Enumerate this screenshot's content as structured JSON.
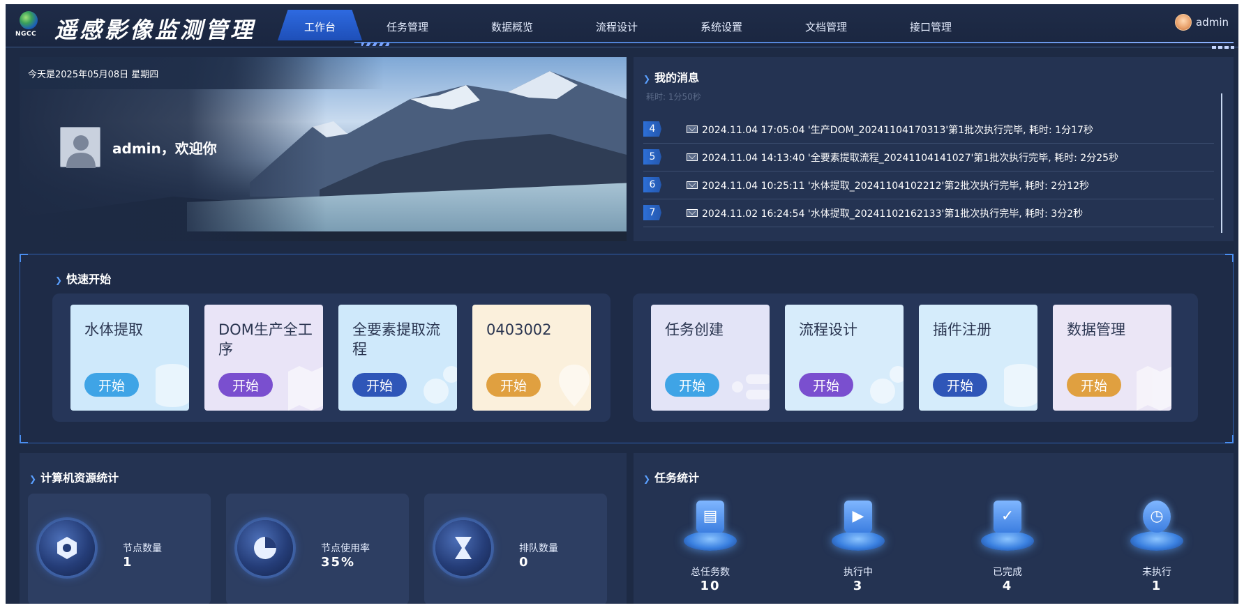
{
  "header": {
    "logo_text": "NGCC",
    "app_title": "遥感影像监测管理",
    "nav": [
      {
        "label": "工作台",
        "active": true
      },
      {
        "label": "任务管理",
        "active": false
      },
      {
        "label": "数据概览",
        "active": false
      },
      {
        "label": "流程设计",
        "active": false
      },
      {
        "label": "系统设置",
        "active": false
      },
      {
        "label": "文档管理",
        "active": false
      },
      {
        "label": "接口管理",
        "active": false
      }
    ],
    "user": {
      "name": "admin",
      "avatar_icon": "user-avatar-icon"
    }
  },
  "welcome": {
    "date_text": "今天是2025年05月08日 星期四",
    "greeting": "admin，欢迎你"
  },
  "messages": {
    "title": "我的消息",
    "faded_text": "耗时: 1分50秒",
    "items": [
      {
        "num": "4",
        "text": "2024.11.04 17:05:04  '生产DOM_20241104170313'第1批次执行完毕, 耗时: 1分17秒"
      },
      {
        "num": "5",
        "text": "2024.11.04 14:13:40  '全要素提取流程_20241104141027'第1批次执行完毕, 耗时: 2分25秒"
      },
      {
        "num": "6",
        "text": "2024.11.04 10:25:11  '水体提取_20241104102212'第2批次执行完毕, 耗时: 2分12秒"
      },
      {
        "num": "7",
        "text": "2024.11.02 16:24:54  '水体提取_20241102162133'第1批次执行完毕, 耗时: 3分2秒"
      }
    ]
  },
  "quick_start": {
    "title": "快速开始",
    "left_cards": [
      {
        "title": "水体提取",
        "button": "开始",
        "bg": "#cfe9fb",
        "btn_color": "#3fa4e6",
        "icon": "database-icon"
      },
      {
        "title": "DOM生产全工序",
        "button": "开始",
        "bg": "#e9e4f7",
        "btn_color": "#7a4fcf",
        "icon": "map-icon"
      },
      {
        "title": "全要素提取流程",
        "button": "开始",
        "bg": "#cfe9fb",
        "btn_color": "#2f56b8",
        "icon": "gear-icon"
      },
      {
        "title": "0403002",
        "button": "开始",
        "bg": "#fbf0dc",
        "btn_color": "#e0a040",
        "icon": "map-pin-icon"
      }
    ],
    "right_cards": [
      {
        "title": "任务创建",
        "button": "开始",
        "bg": "#e3e4f7",
        "btn_color": "#3fa4e6",
        "icon": "task-create-icon"
      },
      {
        "title": "流程设计",
        "button": "开始",
        "bg": "#d7ecfb",
        "btn_color": "#7a4fcf",
        "icon": "gear-icon"
      },
      {
        "title": "插件注册",
        "button": "开始",
        "bg": "#d5ecfb",
        "btn_color": "#2f56b8",
        "icon": "database-icon"
      },
      {
        "title": "数据管理",
        "button": "开始",
        "bg": "#ebe6f6",
        "btn_color": "#e0a040",
        "icon": "map-icon"
      }
    ]
  },
  "resources": {
    "title": "计算机资源统计",
    "items": [
      {
        "label": "节点数量",
        "value": "1",
        "icon": "node-icon"
      },
      {
        "label": "节点使用率",
        "value": "35%",
        "icon": "pie-chart-icon"
      },
      {
        "label": "排队数量",
        "value": "0",
        "icon": "hourglass-icon"
      }
    ]
  },
  "tasks": {
    "title": "任务统计",
    "items": [
      {
        "label": "总任务数",
        "value": "10",
        "icon": "clipboard-icon",
        "glyph": "▤"
      },
      {
        "label": "执行中",
        "value": "3",
        "icon": "calendar-play-icon",
        "glyph": "▶"
      },
      {
        "label": "已完成",
        "value": "4",
        "icon": "shield-check-icon",
        "glyph": "✓"
      },
      {
        "label": "未执行",
        "value": "1",
        "icon": "clock-icon",
        "glyph": "◷"
      }
    ]
  }
}
